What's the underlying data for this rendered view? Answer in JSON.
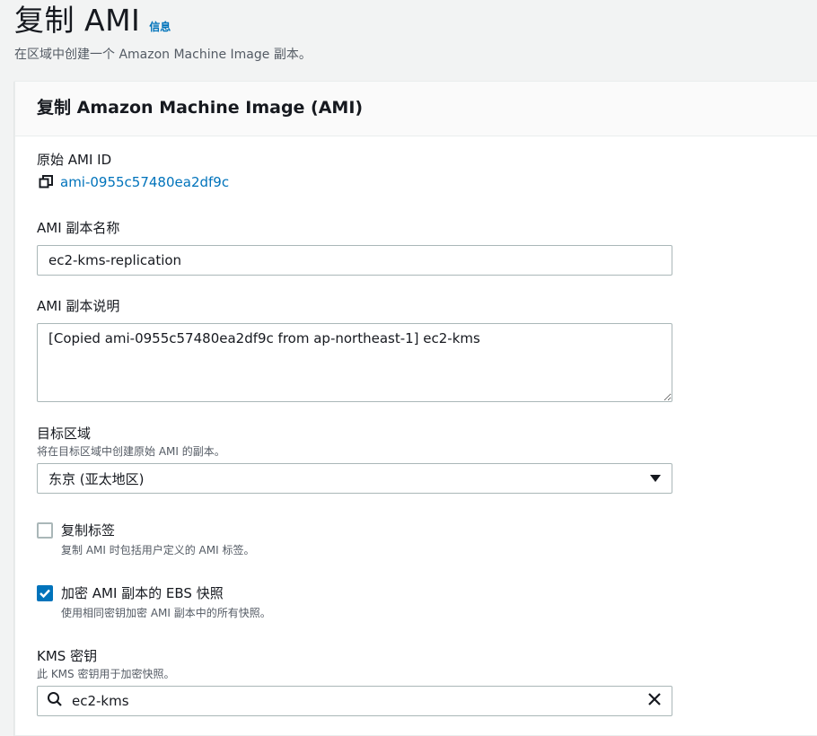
{
  "header": {
    "title": "复制 AMI",
    "info_link": "信息",
    "description": "在区域中创建一个 Amazon Machine Image 副本。"
  },
  "panel": {
    "title": "复制 Amazon Machine Image (AMI)"
  },
  "source_ami": {
    "label": "原始 AMI ID",
    "value": "ami-0955c57480ea2df9c",
    "icon": "copy-icon"
  },
  "copy_name": {
    "label": "AMI 副本名称",
    "value": "ec2-kms-replication"
  },
  "copy_description": {
    "label": "AMI 副本说明",
    "value": "[Copied ami-0955c57480ea2df9c from ap-northeast-1] ec2-kms"
  },
  "destination_region": {
    "label": "目标区域",
    "description": "将在目标区域中创建原始 AMI 的副本。",
    "selected": "东京 (亚太地区)"
  },
  "copy_tags": {
    "label": "复制标签",
    "description": "复制 AMI 时包括用户定义的 AMI 标签。",
    "checked": false
  },
  "encrypt_snapshots": {
    "label": "加密 AMI 副本的 EBS 快照",
    "description": "使用相同密钥加密 AMI 副本中的所有快照。",
    "checked": true
  },
  "kms_key": {
    "label": "KMS 密钥",
    "description": "此 KMS 密钥用于加密快照。",
    "value": "ec2-kms",
    "search_icon": "search-icon",
    "clear_icon": "close-icon"
  },
  "colors": {
    "accent": "#0073bb",
    "border": "#aab7b8",
    "text": "#16191f",
    "muted": "#545b64"
  }
}
